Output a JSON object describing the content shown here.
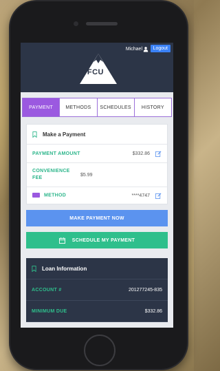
{
  "header": {
    "user_name": "Michael",
    "logout_label": "Logout",
    "logo_text": "WFCU"
  },
  "tabs": [
    {
      "label": "PAYMENT",
      "active": true
    },
    {
      "label": "METHODS",
      "active": false
    },
    {
      "label": "SCHEDULES",
      "active": false
    },
    {
      "label": "HISTORY",
      "active": false
    }
  ],
  "payment_card": {
    "title": "Make a Payment",
    "rows": {
      "amount": {
        "label": "PAYMENT AMOUNT",
        "value": "$332.86"
      },
      "fee": {
        "label": "CONVENIENCE FEE",
        "value": "$5.99"
      },
      "method": {
        "label": "METHOD",
        "value": "****4747"
      }
    }
  },
  "buttons": {
    "make_payment": "MAKE PAYMENT NOW",
    "schedule_payment": "SCHEDULE MY PAYMENT"
  },
  "loan_card": {
    "title": "Loan Information",
    "rows": {
      "account": {
        "label": "ACCOUNT #",
        "value": "201277245-835"
      },
      "minimum_due": {
        "label": "MINIMUM DUE",
        "value": "$332.86"
      }
    }
  },
  "colors": {
    "accent_purple": "#9b59e0",
    "accent_blue": "#5b93ef",
    "accent_green": "#2fbf8c",
    "header_navy": "#2c3547"
  },
  "icons": {
    "user": "user-icon",
    "bookmark": "bookmark-icon",
    "edit": "edit-icon",
    "calendar": "calendar-icon"
  }
}
